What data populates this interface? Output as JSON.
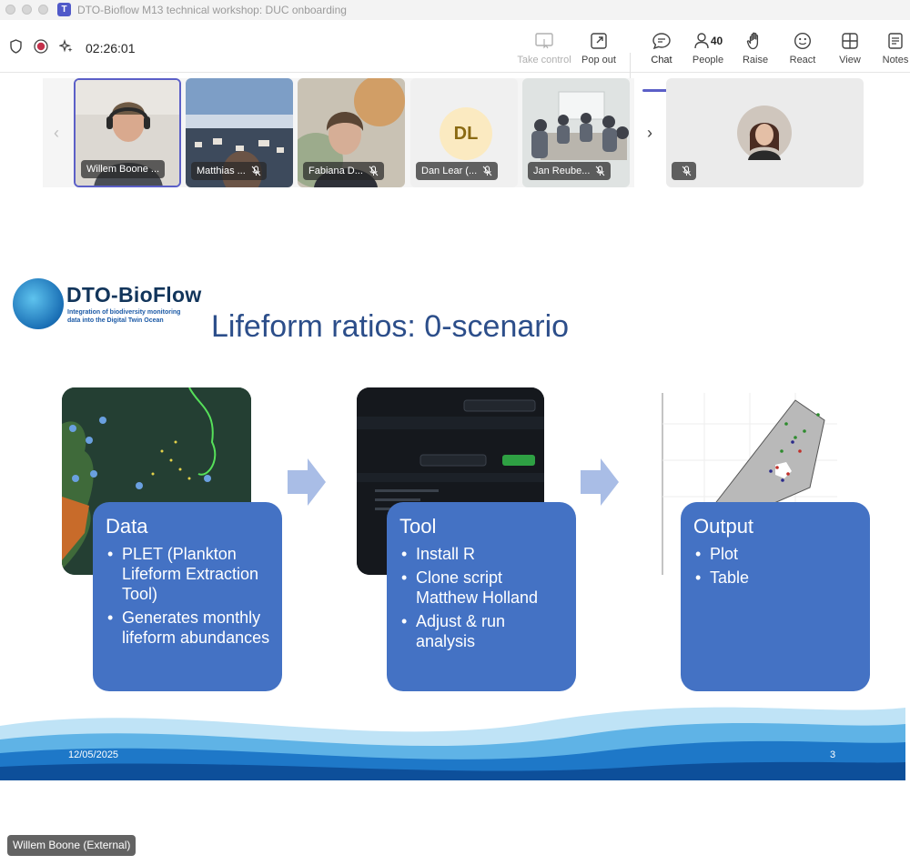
{
  "window": {
    "title": "DTO-Bioflow M13 technical workshop: DUC onboarding"
  },
  "toolbar": {
    "timer": "02:26:01",
    "take_control": "Take control",
    "pop_out": "Pop out",
    "chat": "Chat",
    "people": "People",
    "people_count": "40",
    "raise": "Raise",
    "react": "React",
    "view": "View",
    "notes": "Notes"
  },
  "participants": [
    {
      "name": "Willem Boone ...",
      "muted": false
    },
    {
      "name": "Matthias ...",
      "muted": true
    },
    {
      "name": "Fabiana D...",
      "muted": true
    },
    {
      "name": "Dan Lear (...",
      "initials": "DL",
      "muted": true
    },
    {
      "name": "Jan Reube...",
      "muted": true
    },
    {
      "name": "",
      "muted": true
    }
  ],
  "slide": {
    "logo_name": "DTO-BioFlow",
    "logo_sub_1": "Integration of biodiversity monitoring",
    "logo_sub_2": "data into the Digital Twin Ocean",
    "title": "Lifeform ratios: 0-scenario",
    "boxes": [
      {
        "title": "Data",
        "items": [
          "PLET (Plankton Lifeform Extraction Tool)",
          "Generates monthly lifeform abundances"
        ]
      },
      {
        "title": "Tool",
        "items": [
          "Install R",
          "Clone script Matthew Holland",
          "Adjust & run analysis"
        ]
      },
      {
        "title": "Output",
        "items": [
          "Plot",
          "Table"
        ]
      }
    ],
    "date": "12/05/2025",
    "page": "3"
  },
  "speaker": "Willem Boone (External)",
  "colors": {
    "accent": "#5b5fc7",
    "box": "#4472c4",
    "title": "#2c4e8a"
  }
}
